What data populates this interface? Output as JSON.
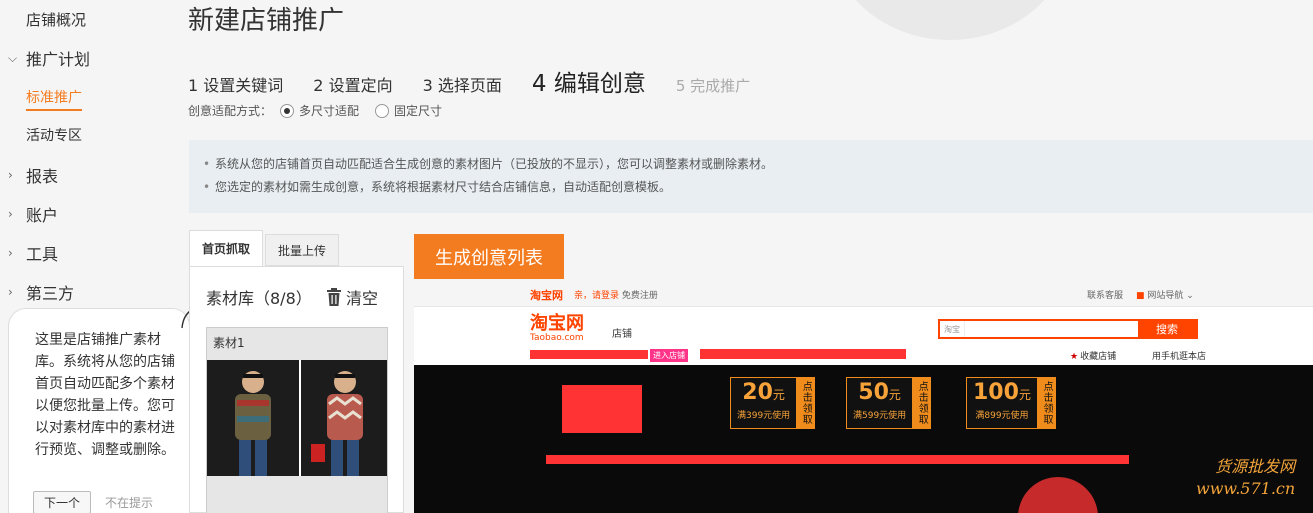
{
  "sidebar": {
    "overview": "店铺概况",
    "promo_plan": "推广计划",
    "standard_promo": "标准推广",
    "activity_zone": "活动专区",
    "reports": "报表",
    "account": "账户",
    "tools": "工具",
    "third_party": "第三方"
  },
  "tooltip": {
    "text": "这里是店铺推广素材库。系统将从您的店铺首页自动匹配多个素材以便您批量上传。您可以对素材库中的素材进行预览、调整或删除。",
    "next_label": "下一个",
    "no_show_label": "不在提示"
  },
  "page": {
    "title": "新建店铺推广"
  },
  "steps": [
    {
      "num": "1",
      "label": "设置关键词"
    },
    {
      "num": "2",
      "label": "设置定向"
    },
    {
      "num": "3",
      "label": "选择页面"
    },
    {
      "num": "4",
      "label": "编辑创意"
    },
    {
      "num": "5",
      "label": "完成推广"
    }
  ],
  "fit_mode": {
    "label": "创意适配方式：",
    "options": [
      "多尺寸适配",
      "固定尺寸"
    ],
    "selected": 0
  },
  "info": {
    "lines": [
      "系统从您的店铺首页自动匹配适合生成创意的素材图片（已投放的不显示），您可以调整素材或删除素材。",
      "您选定的素材如需生成创意，系统将根据素材尺寸结合店铺信息，自动适配创意模板。"
    ]
  },
  "material": {
    "tabs": [
      "首页抓取",
      "批量上传"
    ],
    "library_title": "素材库（8/8）",
    "clear_label": "清空",
    "card_label": "素材1"
  },
  "generate_button": "生成创意列表",
  "preview": {
    "logo_small": "淘宝网",
    "login_hi": "亲，请登录",
    "login_register": "免费注册",
    "favorites_top": "联系客服",
    "site_nav": "网站导航",
    "logo": "淘宝网",
    "logo_domain": "Taobao.com",
    "shop_label": "店铺",
    "search_scope": "淘宝",
    "search_button": "搜索",
    "enter_shop": "进入店铺",
    "fav_shop": "收藏店铺",
    "mobile_shop": "用手机逛本店",
    "coupons": [
      {
        "amount": "20",
        "unit": "元",
        "condition": "满399元使用",
        "get": "点击领取"
      },
      {
        "amount": "50",
        "unit": "元",
        "condition": "满599元使用",
        "get": "点击领取"
      },
      {
        "amount": "100",
        "unit": "元",
        "condition": "满899元使用",
        "get": "点击领取"
      }
    ]
  },
  "watermark": {
    "line1": "货源批发网",
    "line2": "www.571.cn"
  },
  "colors": {
    "accent": "#f47c20",
    "taobao": "#ff4400",
    "info_bg": "#e8eef2"
  }
}
